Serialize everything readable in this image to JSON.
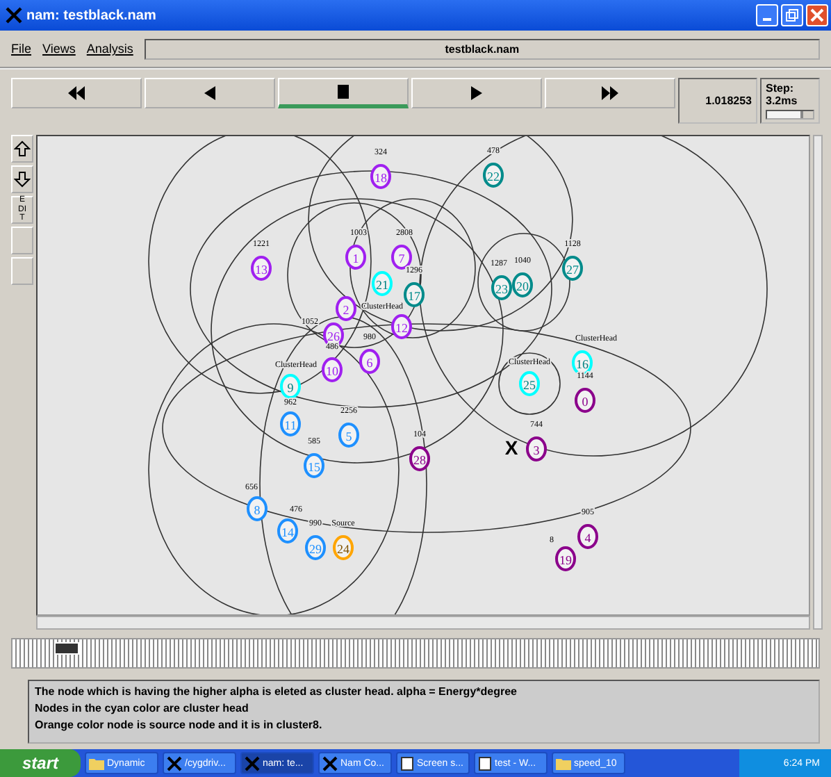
{
  "window": {
    "title": "nam: testblack.nam"
  },
  "menu": [
    "File",
    "Views",
    "Analysis"
  ],
  "file_field": {
    "value": "testblack.nam"
  },
  "playback": [
    {
      "kind": "rewind",
      "selected": false
    },
    {
      "kind": "back",
      "selected": false
    },
    {
      "kind": "stop",
      "selected": true
    },
    {
      "kind": "play",
      "selected": false
    },
    {
      "kind": "forward",
      "selected": false
    }
  ],
  "time": "1.018253",
  "step": {
    "label": "Step: 3.2ms",
    "level": 0.8
  },
  "side_tools": [
    {
      "kind": "zoom-in"
    },
    {
      "kind": "zoom-out"
    },
    {
      "kind": "text",
      "label": "EDIT"
    },
    {
      "kind": "blank"
    },
    {
      "kind": "blank"
    }
  ],
  "nodes": [
    {
      "id": "18",
      "label": "324",
      "color": "#a020f0"
    },
    {
      "id": "22",
      "label": "478",
      "color": "#008b8b"
    },
    {
      "id": "13",
      "label": "1221",
      "color": "#a020f0"
    },
    {
      "id": "2",
      "color": "#a020f0"
    },
    {
      "id": "1",
      "label": "1003",
      "color": "#a020f0"
    },
    {
      "id": "21",
      "label": "ClusterHead",
      "color": "#00ffff"
    },
    {
      "id": "7",
      "label": "2808",
      "color": "#a020f0"
    },
    {
      "id": "17",
      "label": "1296",
      "color": "#008b8b"
    },
    {
      "id": "23",
      "label": "1287",
      "color": "#008b8b"
    },
    {
      "id": "20",
      "label": "1040",
      "color": "#008b8b"
    },
    {
      "id": "27",
      "label": "1128",
      "color": "#008b8b"
    },
    {
      "id": "26",
      "label": "1052",
      "color": "#a020f0"
    },
    {
      "id": "12",
      "color": "#a020f0"
    },
    {
      "id": "9",
      "label": "ClusterHead",
      "color": "#00ffff"
    },
    {
      "id": "10",
      "label": "486",
      "color": "#a020f0"
    },
    {
      "id": "6",
      "label": "980",
      "color": "#a020f0"
    },
    {
      "id": "25",
      "label": "ClusterHead",
      "color": "#00ffff"
    },
    {
      "id": "16",
      "label": "ClusterHead",
      "color": "#00ffff"
    },
    {
      "id": "0",
      "label": "1144",
      "color": "#8b008b"
    },
    {
      "id": "11",
      "label": "962",
      "color": "#1e90ff"
    },
    {
      "id": "15",
      "label": "585",
      "color": "#1e90ff"
    },
    {
      "id": "5",
      "label": "2256",
      "color": "#1e90ff"
    },
    {
      "id": "28",
      "label": "104",
      "color": "#8b008b"
    },
    {
      "id": "3",
      "label": "744",
      "color": "#8b008b"
    },
    {
      "id": "8",
      "label": "656",
      "color": "#1e90ff"
    },
    {
      "id": "14",
      "label": "476",
      "color": "#1e90ff"
    },
    {
      "id": "29",
      "label": "990",
      "color": "#1e90ff"
    },
    {
      "id": "24",
      "label": "Source",
      "color": "#ffa500"
    },
    {
      "id": "19",
      "label": "8",
      "color": "#8b008b"
    },
    {
      "id": "4",
      "label": "905",
      "color": "#8b008b"
    }
  ],
  "marker": "X",
  "annotations": [
    "The node which is having the higher alpha is eleted as cluster head. alpha = Energy*degree",
    "Nodes in the cyan color are cluster head",
    "Orange color node is source node and it is in cluster8."
  ],
  "taskbar": {
    "start": "start",
    "items": [
      {
        "kind": "folder",
        "label": "Dynamic",
        "selected": false
      },
      {
        "kind": "x",
        "label": "/cygdriv...",
        "selected": false
      },
      {
        "kind": "x",
        "label": "nam: te...",
        "selected": true
      },
      {
        "kind": "x",
        "label": "Nam Co...",
        "selected": false
      },
      {
        "kind": "doc",
        "label": "Screen s...",
        "selected": false
      },
      {
        "kind": "doc",
        "label": "test - W...",
        "selected": false
      },
      {
        "kind": "folder",
        "label": "speed_10",
        "selected": false
      }
    ],
    "clock": "6:24 PM"
  }
}
